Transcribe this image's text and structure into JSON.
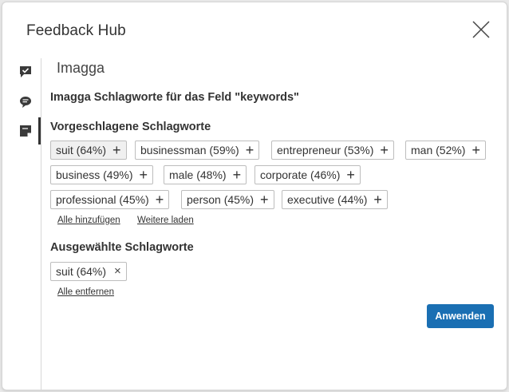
{
  "window": {
    "title": "Feedback Hub"
  },
  "section": {
    "title": "Imagga"
  },
  "intro": {
    "text": "Imagga Schlagworte für das Feld \"keywords\""
  },
  "suggested": {
    "heading": "Vorgeschlagene Schlagworte",
    "tags": [
      {
        "label": "suit (64%)",
        "selected": true
      },
      {
        "label": "businessman (59%)",
        "selected": false
      },
      {
        "label": "entrepreneur (53%)",
        "selected": false
      },
      {
        "label": "man (52%)",
        "selected": false
      },
      {
        "label": "business (49%)",
        "selected": false
      },
      {
        "label": "male (48%)",
        "selected": false
      },
      {
        "label": "corporate (46%)",
        "selected": false
      },
      {
        "label": "professional (45%)",
        "selected": false
      },
      {
        "label": "person (45%)",
        "selected": false
      },
      {
        "label": "executive (44%)",
        "selected": false
      }
    ],
    "add_all": "Alle hinzufügen",
    "load_more": "Weitere laden"
  },
  "selected": {
    "heading": "Ausgewählte Schlagworte",
    "tags": [
      {
        "label": "suit (64%)"
      }
    ],
    "remove_all": "Alle entfernen"
  },
  "actions": {
    "apply": "Anwenden"
  },
  "glyphs": {
    "add": "+",
    "remove": "×"
  },
  "icons": {
    "close": "close-icon",
    "sidebar": [
      "chat-check-icon",
      "speech-bubble-icon",
      "note-icon"
    ]
  },
  "colors": {
    "accent": "#1a6fb3",
    "text": "#333333",
    "border": "#bdbdbd"
  }
}
